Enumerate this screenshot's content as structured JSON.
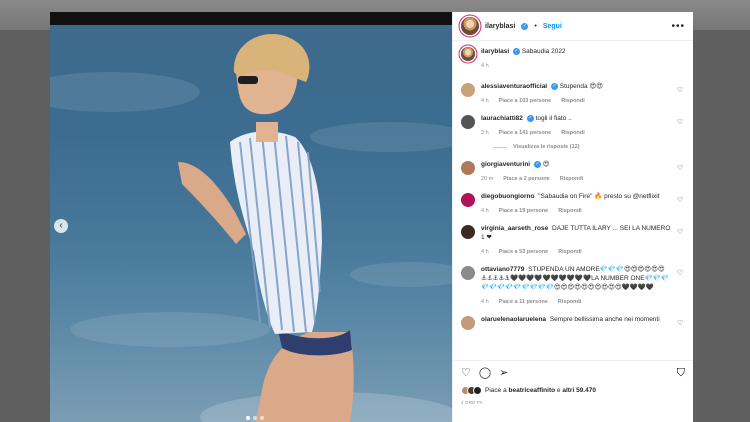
{
  "post": {
    "username": "ilaryblasi",
    "follow_label": "Segui",
    "separator": "•",
    "more": "•••",
    "caption_text": "Sabaudia 2022",
    "caption_time": "4 h"
  },
  "comments": [
    {
      "user": "alessiaventuraofficial",
      "verified": true,
      "text": "Stupenda 😍😍",
      "time": "4 h",
      "likes": "Piace a 103 persone",
      "reply": "Rispondi",
      "avatar_color": "#c9a27a"
    },
    {
      "user": "laurachiatti82",
      "verified": true,
      "text": "togli il fiato ..",
      "time": "3 h",
      "likes": "Piace a 141 persone",
      "reply": "Rispondi",
      "avatar_color": "#555555",
      "view_replies": "Visualizza le risposte (12)"
    },
    {
      "user": "giorgiaventurini",
      "verified": true,
      "text": "😍",
      "time": "20 m",
      "likes": "Piace a 2 persone",
      "reply": "Rispondi",
      "avatar_color": "#b07a5a"
    },
    {
      "user": "diegobuongiorno",
      "verified": false,
      "text": "\"Sabaudia on Fire\" 🔥 presto su @netflixit",
      "time": "4 h",
      "likes": "Piace a 19 persone",
      "reply": "Rispondi",
      "avatar_color": "#b0145a"
    },
    {
      "user": "virginia_aarseth_rose",
      "verified": false,
      "text": "DAJE TUTTA ILARY ... SEI LA NUMERO 1 ❤",
      "time": "4 h",
      "likes": "Piace a 53 persone",
      "reply": "Rispondi",
      "avatar_color": "#3a2a22"
    },
    {
      "user": "ottaviano7779",
      "verified": false,
      "text": "STUPENDA UN AMORE💎💎💎😍😍😍😍😍😍⚓⚓⚓⚓⚓🖤🖤🖤🖤🖤🖤🖤🖤🖤🖤LA NUMBER ONE💎💎💎💎💎💎💎💎💎💎💎💎😍😍😍😍😍😍😍😍😍😍🖤🖤🖤🖤",
      "time": "4 h",
      "likes": "Piace a 11 persone",
      "reply": "Rispondi",
      "avatar_color": "#8a8a8a"
    },
    {
      "user": "olaruelenaolaruelena",
      "verified": false,
      "text": "Sempre bellissima anche nei momenti",
      "time": "",
      "likes": "",
      "reply": "",
      "avatar_color": "#c49a7a"
    }
  ],
  "actions": {
    "like_icon": "heart-icon",
    "comment_icon": "comment-icon",
    "share_icon": "share-icon",
    "save_icon": "bookmark-icon",
    "likes_prefix": "Piace a",
    "likes_user": "beatriceaffinito",
    "likes_middle": "e",
    "likes_others": "altri 59.470",
    "time_ago": "4 ORE FA"
  },
  "carousel": {
    "position": 1,
    "count": 3
  }
}
